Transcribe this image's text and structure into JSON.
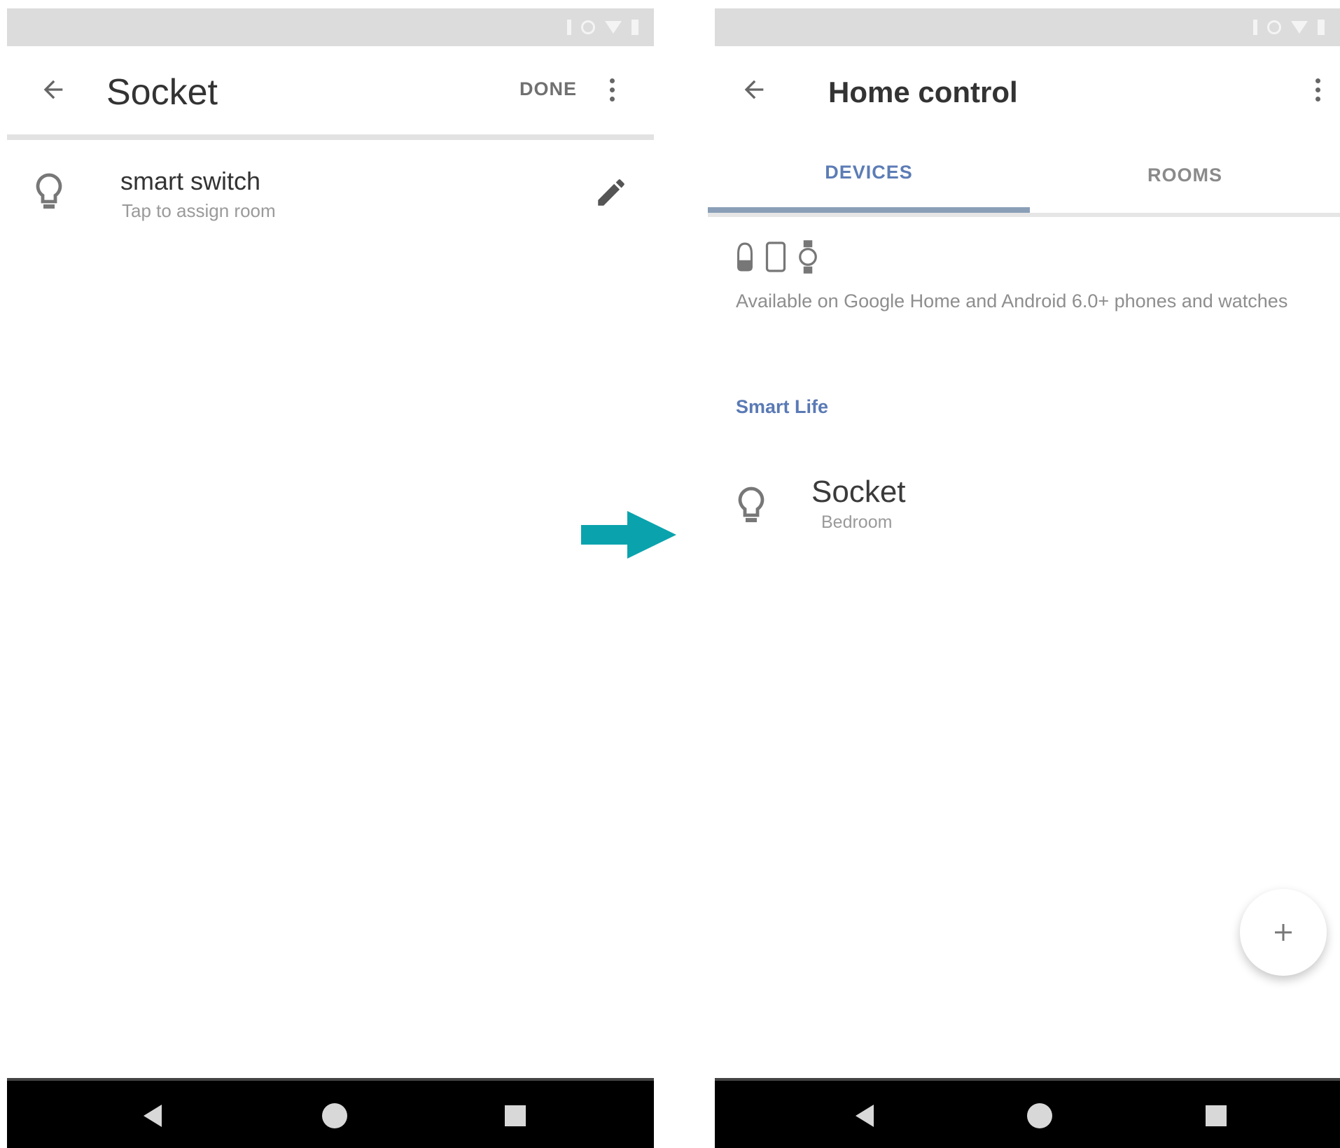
{
  "left_screen": {
    "title": "Socket",
    "done_label": "DONE",
    "item": {
      "title": "smart switch",
      "subtitle": "Tap to assign room"
    }
  },
  "right_screen": {
    "title": "Home control",
    "tabs": [
      {
        "label": "DEVICES",
        "selected": true
      },
      {
        "label": "ROOMS",
        "selected": false
      }
    ],
    "availability_text": "Available on Google Home and Android 6.0+ phones and watches",
    "section_header": "Smart Life",
    "device": {
      "title": "Socket",
      "subtitle": "Bedroom"
    },
    "fab_icon": "plus-icon"
  },
  "icons": {
    "back": "back-arrow-icon",
    "more": "more-vert-icon",
    "bulb": "lightbulb-icon",
    "edit": "pencil-icon",
    "flow": "right-arrow-icon"
  },
  "colors": {
    "accent_tab": "#5c7cb5",
    "section_header": "#5a7ab5",
    "flow_arrow": "#0aa3ad",
    "status_bar": "#dcdcdc",
    "nav_bar": "#000000"
  }
}
